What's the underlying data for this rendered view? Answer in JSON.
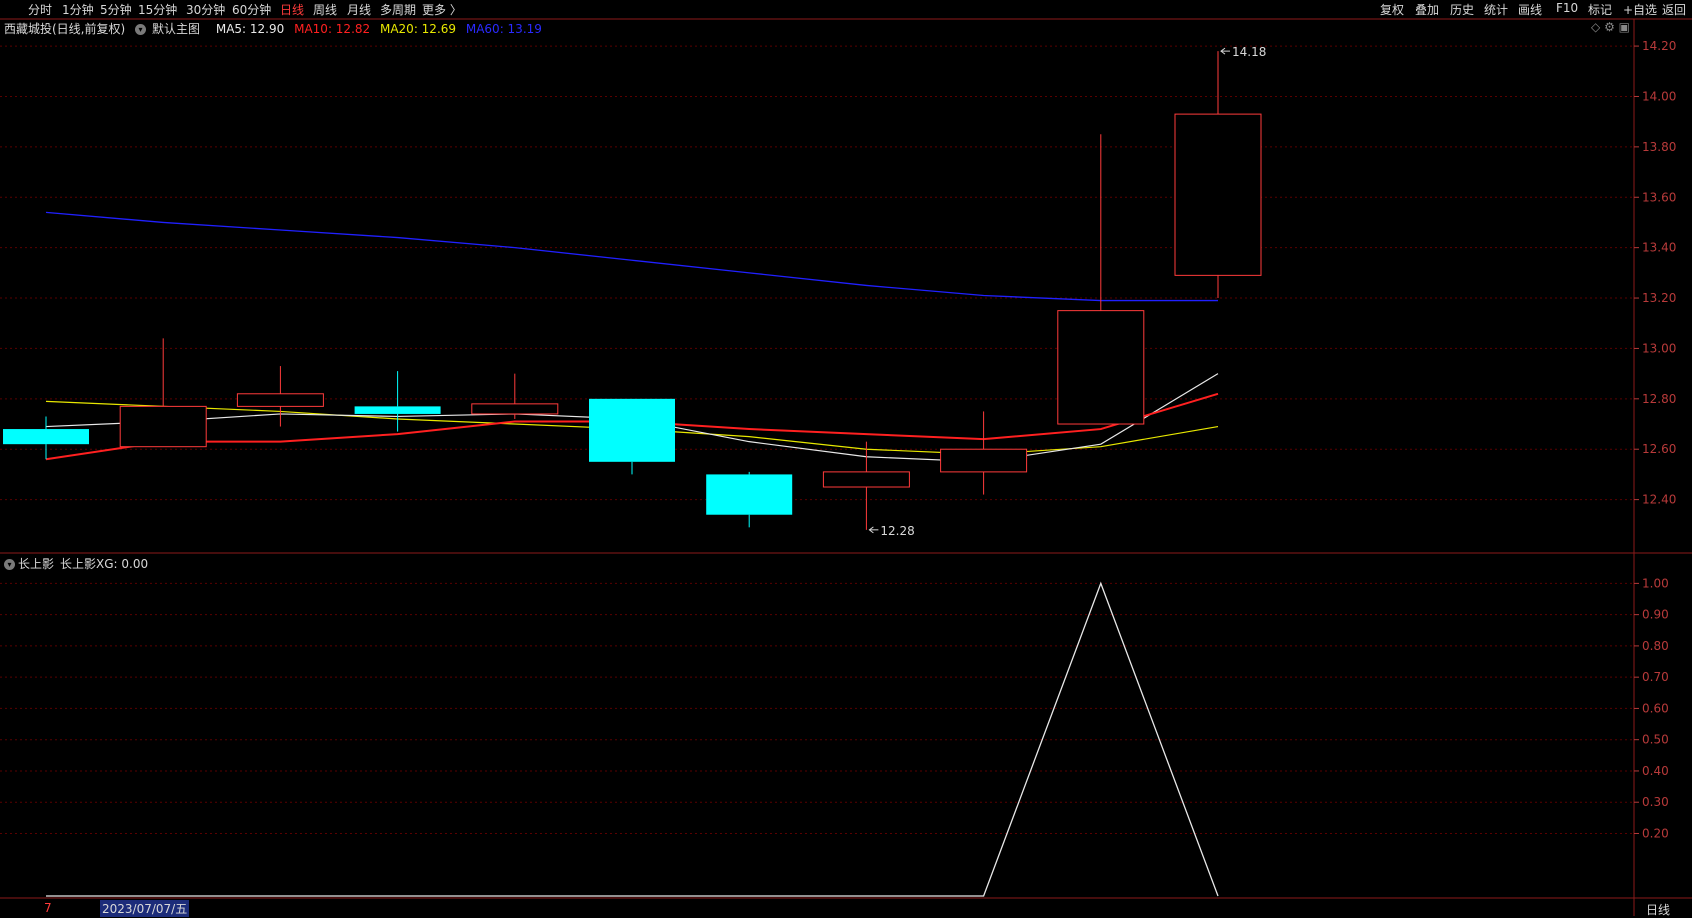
{
  "toolbar": {
    "periods": [
      "分时",
      "1分钟",
      "5分钟",
      "15分钟",
      "30分钟",
      "60分钟",
      "日线",
      "周线",
      "月线",
      "多周期",
      "更多 〉"
    ],
    "active_period": "日线",
    "right_tools": [
      "复权",
      "叠加",
      "历史",
      "统计",
      "画线",
      "F10",
      "标记",
      "+自选",
      "返回"
    ]
  },
  "main_header": {
    "stock_title": "西藏城投(日线,前复权)",
    "template": "默认主图",
    "ma5": "MA5: 12.90",
    "ma10": "MA10: 12.82",
    "ma20": "MA20: 12.69",
    "ma60": "MA60: 13.19"
  },
  "sub_header": {
    "indicator_name": "长上影",
    "value_label": "长上影XG: 0.00"
  },
  "date_bar": {
    "left_mark": "7",
    "cursor_date": "2023/07/07/五",
    "period_label": "日线"
  },
  "colors": {
    "up": "#ff3b3b",
    "down": "#00ffff",
    "ma5": "#e8e8e8",
    "ma10": "#ff2020",
    "ma20": "#e8e800",
    "ma60": "#2020ff",
    "grid": "#5a0000"
  },
  "chart_data": [
    {
      "type": "candlestick",
      "title": "西藏城投(日线,前复权)",
      "ylim": [
        12.2,
        14.24
      ],
      "y_ticks": [
        12.4,
        12.6,
        12.8,
        13.0,
        13.2,
        13.4,
        13.6,
        13.8,
        14.0,
        14.2
      ],
      "candles": [
        {
          "o": 12.68,
          "c": 12.62,
          "h": 12.73,
          "l": 12.56
        },
        {
          "o": 12.61,
          "c": 12.77,
          "h": 13.04,
          "l": 12.61
        },
        {
          "o": 12.77,
          "c": 12.82,
          "h": 12.93,
          "l": 12.69
        },
        {
          "o": 12.77,
          "c": 12.74,
          "h": 12.91,
          "l": 12.67
        },
        {
          "o": 12.74,
          "c": 12.78,
          "h": 12.9,
          "l": 12.72
        },
        {
          "o": 12.8,
          "c": 12.55,
          "h": 12.8,
          "l": 12.5
        },
        {
          "o": 12.5,
          "c": 12.34,
          "h": 12.51,
          "l": 12.29
        },
        {
          "o": 12.45,
          "c": 12.51,
          "h": 12.63,
          "l": 12.28
        },
        {
          "o": 12.51,
          "c": 12.6,
          "h": 12.75,
          "l": 12.42
        },
        {
          "o": 12.7,
          "c": 13.15,
          "h": 13.85,
          "l": 12.7
        },
        {
          "o": 13.29,
          "c": 13.93,
          "h": 14.18,
          "l": 13.2
        }
      ],
      "ma5": [
        12.69,
        12.71,
        12.74,
        12.73,
        12.74,
        12.72,
        12.63,
        12.57,
        12.55,
        12.62,
        12.9
      ],
      "ma10": [
        12.56,
        12.63,
        12.63,
        12.66,
        12.71,
        12.71,
        12.68,
        12.66,
        12.64,
        12.68,
        12.82
      ],
      "ma20": [
        12.79,
        12.77,
        12.75,
        12.72,
        12.7,
        12.68,
        12.65,
        12.6,
        12.58,
        12.61,
        12.69
      ],
      "ma60": [
        13.54,
        13.5,
        13.47,
        13.44,
        13.4,
        13.35,
        13.3,
        13.25,
        13.21,
        13.19,
        13.19
      ],
      "annotations": [
        {
          "label": "14.18",
          "candle": 10,
          "value": 14.18
        },
        {
          "label": "12.28",
          "candle": 7,
          "value": 12.28
        }
      ]
    },
    {
      "type": "line",
      "title": "长上影",
      "ylim": [
        0,
        1.03
      ],
      "y_ticks": [
        0.2,
        0.3,
        0.4,
        0.5,
        0.6,
        0.7,
        0.8,
        0.9,
        1.0
      ],
      "values": [
        0,
        0,
        0,
        0,
        0,
        0,
        0,
        0,
        0,
        1,
        0
      ]
    }
  ]
}
